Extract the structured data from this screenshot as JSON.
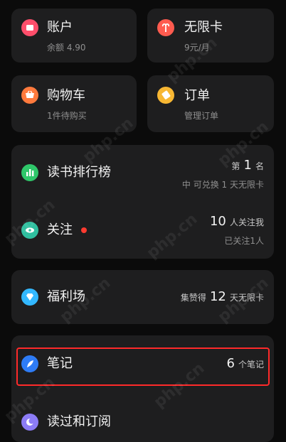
{
  "top_cards": {
    "account": {
      "title": "账户",
      "sub": "余额 4.90",
      "color": "#ff4e6b"
    },
    "unlimited": {
      "title": "无限卡",
      "sub": "9元/月",
      "color": "#ff5b4f"
    },
    "cart": {
      "title": "购物车",
      "sub": "1件待购买",
      "color": "#ff7a3d"
    },
    "orders": {
      "title": "订单",
      "sub": "管理订单",
      "color": "#f7b733"
    }
  },
  "ranking": {
    "title": "读书排行榜",
    "rank_prefix": "第",
    "rank_value": "1",
    "rank_suffix": "名",
    "note": "中 可兑换 1 天无限卡",
    "color": "#2fc76a"
  },
  "follow": {
    "title": "关注",
    "count": "10",
    "count_label": "人关注我",
    "note": "已关注1人",
    "color": "#2fbf9f"
  },
  "welfare": {
    "title": "福利场",
    "prefix": "集赞得",
    "value": "12",
    "suffix": "天无限卡",
    "color": "#33b8ff"
  },
  "notes": {
    "title": "笔记",
    "count": "6",
    "count_label": "个笔记",
    "color": "#2e7cf6"
  },
  "read_sub": {
    "title": "读过和订阅",
    "color": "#8c7cf6"
  },
  "watermark": "php.cn"
}
